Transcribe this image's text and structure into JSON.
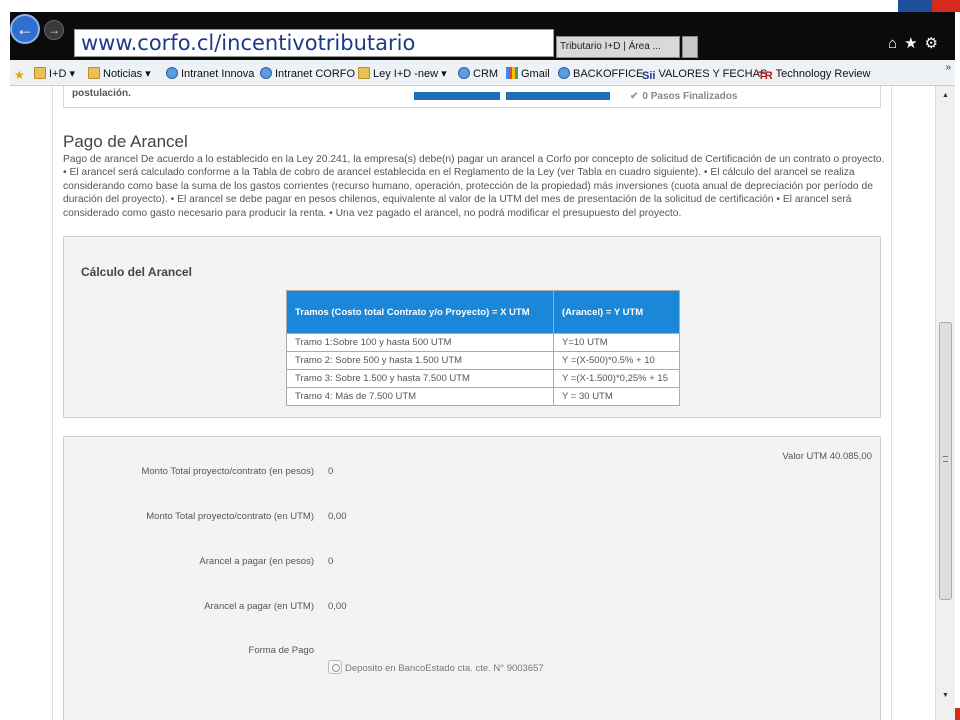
{
  "browser": {
    "url": "www.corfo.cl/incentivotributario",
    "tab_title": "Tributario I+D | Área ...",
    "back_glyph": "←",
    "forward_glyph": "→",
    "toolbar_glyphs": [
      "⌂",
      "★",
      "⚙"
    ]
  },
  "favorites": {
    "items": [
      {
        "label": "I+D",
        "icon": "folder-icon",
        "dropdown": true
      },
      {
        "label": "Noticias",
        "icon": "folder-icon",
        "dropdown": true
      },
      {
        "label": "Intranet Innova",
        "icon": "ie-page-icon",
        "dropdown": false
      },
      {
        "label": "Intranet CORFO",
        "icon": "ie-page-icon",
        "dropdown": false
      },
      {
        "label": "Ley I+D -new",
        "icon": "folder-icon",
        "dropdown": true
      },
      {
        "label": "CRM",
        "icon": "ie-page-icon",
        "dropdown": false
      },
      {
        "label": "Gmail",
        "icon": "google-icon",
        "dropdown": false
      },
      {
        "label": "BACKOFFICE",
        "icon": "ie-page-icon",
        "dropdown": false
      },
      {
        "label": "VALORES Y FECHAS",
        "icon": "sii-icon",
        "dropdown": false
      },
      {
        "label": "Technology Review",
        "icon": "tr-icon",
        "dropdown": false
      }
    ],
    "more_glyph": "»"
  },
  "top_section": {
    "postulacion": "postulación.",
    "pasos": "0 Pasos Finalizados"
  },
  "pago": {
    "title": "Pago de Arancel",
    "text": "Pago de arancel De acuerdo a lo establecido en la Ley 20.241, la empresa(s) debe(n) pagar un arancel a Corfo por concepto de solicitud de Certificación de un contrato o proyecto. • El arancel será calculado conforme a la Tabla de cobro de arancel establecida en el Reglamento de la Ley (ver Tabla en cuadro siguiente). • El cálculo del arancel se realiza considerando como base la suma de los gastos corrientes (recurso humano, operación, protección de la propiedad) más inversiones (cuota anual de depreciación por período de duración del proyecto). • El arancel se debe pagar en pesos chilenos, equivalente al valor de la UTM del mes de presentación de la solicitud de certificación • El arancel será considerado como gasto necesario para producir la renta. • Una vez pagado el arancel, no podrá modificar el presupuesto del proyecto."
  },
  "calculo": {
    "title": "Cálculo del Arancel",
    "headers": [
      "Tramos (Costo total Contrato y/o Proyecto) = X UTM",
      "(Arancel) = Y UTM"
    ],
    "rows": [
      [
        "Tramo 1:Sobre 100 y hasta 500 UTM",
        "Y=10 UTM"
      ],
      [
        "Tramo 2: Sobre 500 y hasta 1.500 UTM",
        "Y =(X-500)*0.5% + 10"
      ],
      [
        "Tramo 3: Sobre 1.500 y hasta 7.500 UTM",
        "Y =(X-1.500)*0,25% + 15"
      ],
      [
        "Tramo 4: Más de 7.500 UTM",
        "Y = 30 UTM"
      ]
    ]
  },
  "monto": {
    "valor_utm": "Valor UTM 40.085,00",
    "fields": [
      {
        "label": "Monto Total proyecto/contrato (en pesos)",
        "value": "0"
      },
      {
        "label": "Monto Total proyecto/contrato (en UTM)",
        "value": "0,00"
      },
      {
        "label": "Arancel a pagar (en pesos)",
        "value": "0"
      },
      {
        "label": "Arancel a pagar (en UTM)",
        "value": "0,00"
      }
    ],
    "forma_pago_label": "Forma de Pago",
    "deposito_option": "Deposito en BancoEstado cta. cte. N° 9003657"
  }
}
